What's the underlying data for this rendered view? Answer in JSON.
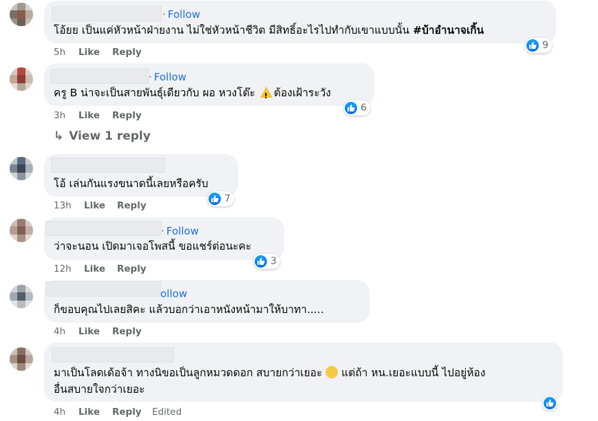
{
  "comments": [
    {
      "follow": "Follow",
      "text_plain": "โอ้ยย เป็นแค่หัวหน้าฝ่ายงาน ไม่ใช่หัวหน้าชีวิต มีสิทธิ์อะไรไปทำกับเขาแบบนั้น ",
      "text_bold": "#บ้าอำนาจเกิ้น",
      "time": "5h",
      "like": "Like",
      "reply": "Reply",
      "reactions": "9"
    },
    {
      "follow": "Follow",
      "text_before": "ครู B น่าจะเป็นสายพันธุ์เดียวกับ ผอ หวงโต๊ะ ",
      "text_after": "ต้องเฝ้าระวัง",
      "time": "3h",
      "like": "Like",
      "reply": "Reply",
      "reactions": "6"
    },
    {
      "text": "โอ้ เล่นกันแรงขนาดนี้เลยหรือครับ",
      "time": "13h",
      "like": "Like",
      "reply": "Reply",
      "reactions": "7"
    },
    {
      "follow": "Follow",
      "text": "ว่าจะนอน เปิดมาเจอโพสนี้ ขอแชร์ต่อนะคะ",
      "time": "12h",
      "like": "Like",
      "reply": "Reply",
      "reactions": "3"
    },
    {
      "follow": "ollow",
      "text": "ก็ขอบคุณไปเลยสิคะ แล้วบอกว่าเอาหนังหน้ามาให้บาทา.....",
      "time": "4h",
      "like": "Like",
      "reply": "Reply"
    },
    {
      "text_line1_before": "มาเป็นโลดเด้อจ้า ทางนิขอเป็นลูกหมวดดอก สบายกว่าเยอะ ",
      "text_line1_after": " แต่ถ้า หน.เยอะแบบนี้ ไปอยู่ห้อง",
      "text_line2": "อื่นสบายใจกว่าเยอะ",
      "time": "4h",
      "like": "Like",
      "reply": "Reply",
      "edited": "Edited"
    }
  ],
  "view_reply": "View 1 reply",
  "icons": {
    "like": "thumbs-up-icon",
    "reply_arrow": "reply-arrow-icon",
    "warning": "warning-emoji",
    "grin": "grin-emoji"
  },
  "colors": {
    "follow": "#216fdb",
    "bubble": "#f0f2f5",
    "meta": "#65676b",
    "like_blue": "#0570e6"
  }
}
